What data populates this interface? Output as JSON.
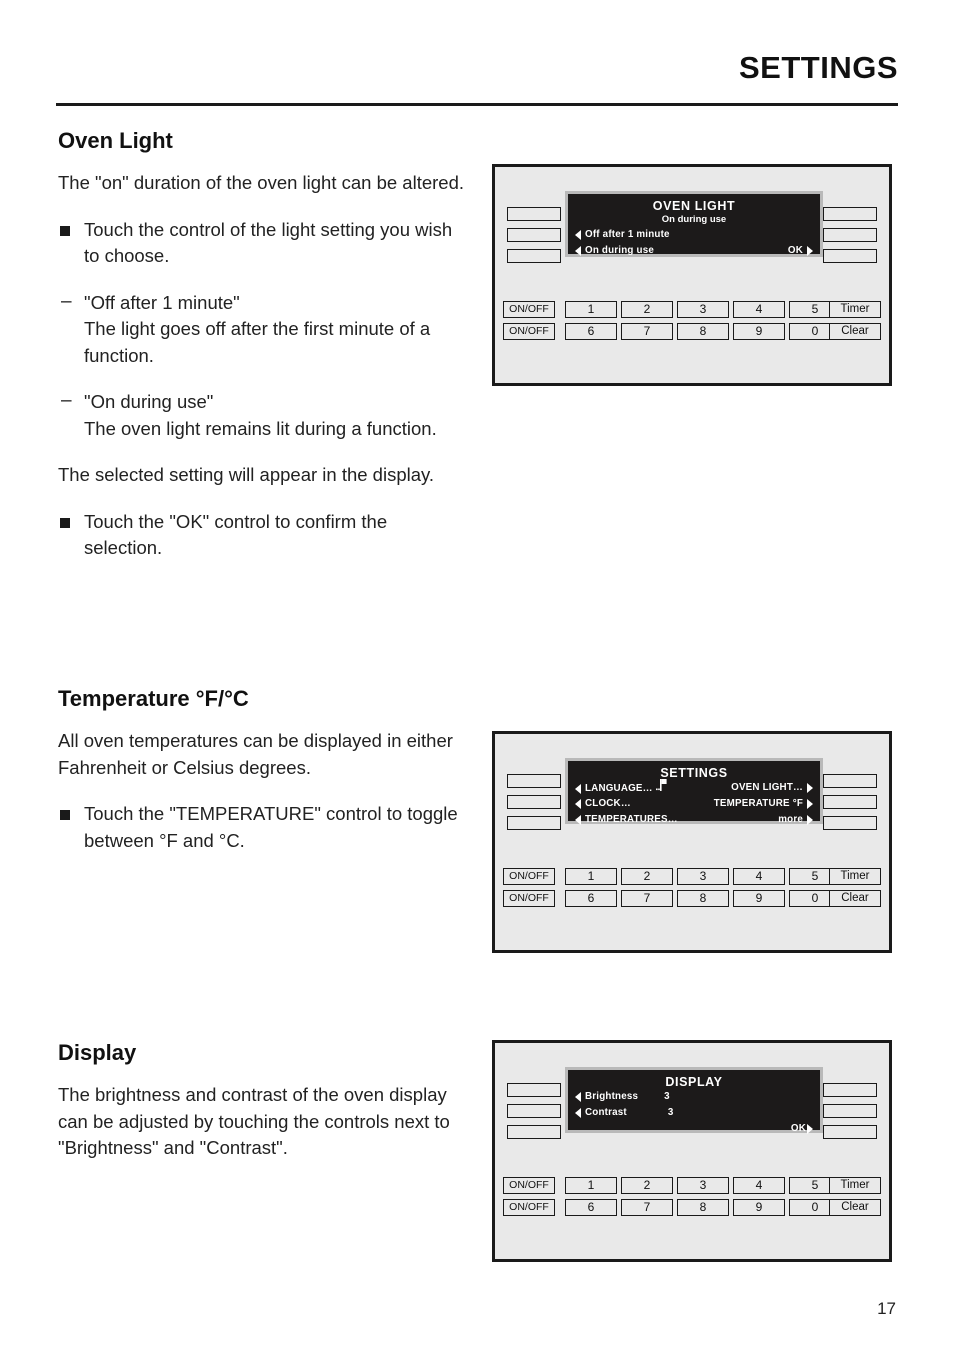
{
  "header": {
    "title": "SETTINGS"
  },
  "sections": [
    {
      "heading": "Oven Light",
      "blocks": [
        {
          "kind": "para",
          "text": "The \"on\" duration of the oven light can be altered."
        },
        {
          "kind": "square",
          "text": "Touch the control of the light setting you wish to choose."
        },
        {
          "kind": "dash",
          "text": "\"Off after 1 minute\"\nThe light goes off after the first minute of a function."
        },
        {
          "kind": "dash",
          "text": "\"On during use\"\nThe oven light remains lit during a function."
        },
        {
          "kind": "para",
          "text": "The selected setting will appear in the display."
        },
        {
          "kind": "square",
          "text": "Touch the \"OK\" control to confirm the selection."
        }
      ]
    },
    {
      "heading": "Temperature °F/°C",
      "blocks": [
        {
          "kind": "para",
          "text": "All oven temperatures can be displayed in either Fahrenheit or Celsius degrees."
        },
        {
          "kind": "square",
          "text": "Touch the \"TEMPERATURE\" control to toggle between °F and °C."
        }
      ]
    },
    {
      "heading": "Display",
      "blocks": [
        {
          "kind": "para",
          "text": "The brightness and contrast of the oven display can be adjusted by touching the controls next to \"Brightness\" and \"Contrast\"."
        }
      ]
    }
  ],
  "panels": [
    {
      "id": "oven-light-panel",
      "lcd": {
        "title": "OVEN LIGHT",
        "subtitle": "On during use",
        "rows_left": [
          {
            "label": "Off after 1 minute",
            "arrow": "left"
          },
          {
            "label": "On during use",
            "arrow": "left"
          }
        ],
        "rows_right": [
          {
            "label": "OK",
            "arrow": "right"
          }
        ]
      }
    },
    {
      "id": "settings-panel",
      "lcd": {
        "title": "SETTINGS",
        "subtitle": "",
        "rows_left": [
          {
            "label": "LANGUAGE…",
            "arrow": "left",
            "icon": "flag-icon"
          },
          {
            "label": "CLOCK…",
            "arrow": "left"
          },
          {
            "label": "TEMPERATURES…",
            "arrow": "left"
          }
        ],
        "rows_right": [
          {
            "label": "OVEN LIGHT…",
            "arrow": "right"
          },
          {
            "label": "TEMPERATURE °F",
            "arrow": "right"
          },
          {
            "label": "more",
            "arrow": "right"
          }
        ]
      }
    },
    {
      "id": "display-panel",
      "lcd": {
        "title": "DISPLAY",
        "subtitle": "",
        "rows_left": [
          {
            "label": "Brightness",
            "value": "3",
            "arrow": "left"
          },
          {
            "label": "Contrast",
            "value": "3",
            "arrow": "left"
          }
        ],
        "rows_right": [
          {
            "label": "OK",
            "arrow": "right"
          }
        ]
      }
    }
  ],
  "keypad": {
    "row1": [
      "1",
      "2",
      "3",
      "4",
      "5"
    ],
    "row2": [
      "6",
      "7",
      "8",
      "9",
      "0"
    ],
    "onoff": [
      "ON/OFF",
      "ON/OFF"
    ],
    "right": [
      "Timer",
      "Clear"
    ]
  },
  "footer": {
    "page_number": "17"
  },
  "colors": {
    "panel_bg": "#e9e9e9",
    "lcd_bg": "#1c1a1a",
    "lcd_bezel": "#b9b9b9",
    "ink": "#1a1a1a"
  }
}
